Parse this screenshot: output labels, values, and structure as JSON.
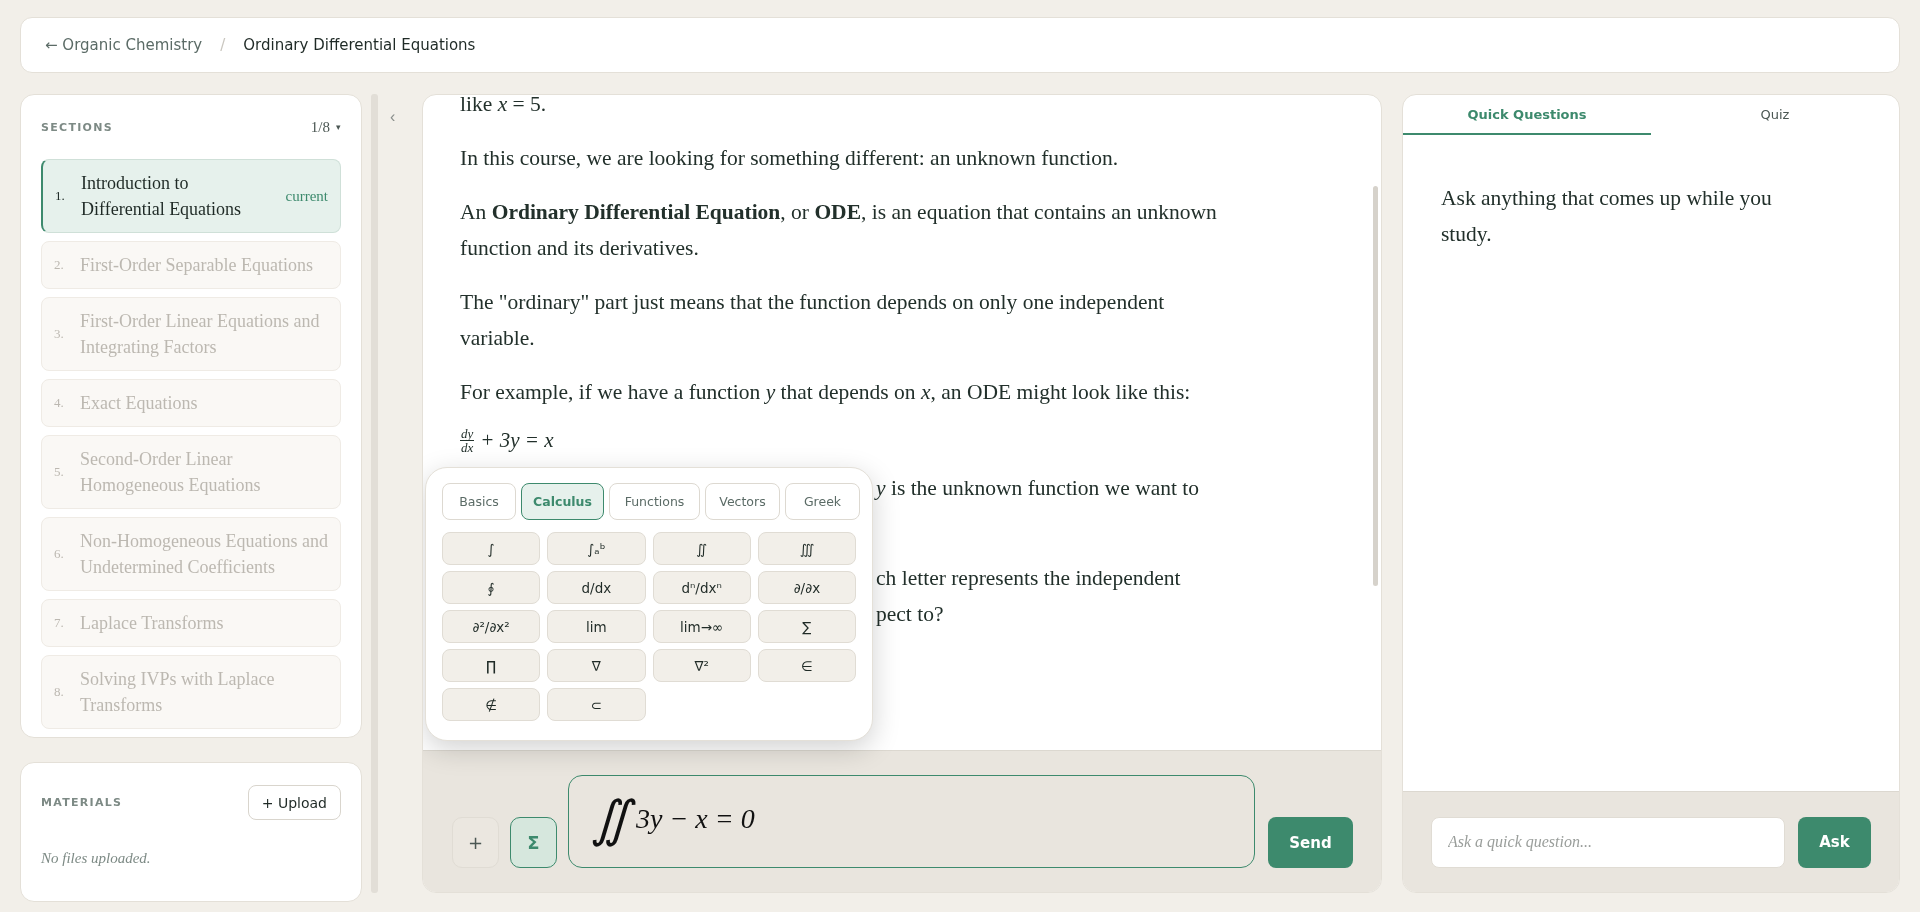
{
  "breadcrumb": {
    "back": "← Organic Chemistry",
    "separator": "/",
    "current": "Ordinary Differential Equations"
  },
  "sections": {
    "heading": "SECTIONS",
    "counter": "1/8",
    "dropdown": "▾",
    "items": [
      {
        "number": "1.",
        "title": "Introduction to Differential Equations",
        "badge": "current",
        "selected": true,
        "disabled": false
      },
      {
        "number": "2.",
        "title": "First-Order Separable Equations",
        "selected": false,
        "disabled": true
      },
      {
        "number": "3.",
        "title": "First-Order Linear Equations and Integrating Factors",
        "selected": false,
        "disabled": true
      },
      {
        "number": "4.",
        "title": "Exact Equations",
        "selected": false,
        "disabled": true
      },
      {
        "number": "5.",
        "title": "Second-Order Linear Homogeneous Equations",
        "selected": false,
        "disabled": true
      },
      {
        "number": "6.",
        "title": "Non-Homogeneous Equations and Undetermined Coefficients",
        "selected": false,
        "disabled": true
      },
      {
        "number": "7.",
        "title": "Laplace Transforms",
        "selected": false,
        "disabled": true
      },
      {
        "number": "8.",
        "title": "Solving IVPs with Laplace Transforms",
        "selected": false,
        "disabled": true
      }
    ]
  },
  "collapse": "‹",
  "materials": {
    "heading": "MATERIALS",
    "upload": "+ Upload",
    "empty": "No files uploaded."
  },
  "lesson": {
    "blocks": [
      {
        "kind": "text",
        "text": "like *x* = 5."
      },
      {
        "kind": "text",
        "text": "In this course, we are looking for something different: an unknown function."
      },
      {
        "kind": "text",
        "text": "An **Ordinary Differential Equation**, or **ODE**, is an equation that contains an unknown function and its derivatives."
      },
      {
        "kind": "text",
        "text": "The \"ordinary\" part just means that the function depends on only one independent variable."
      },
      {
        "kind": "text",
        "text": "For example, if we have a function *y* that depends on *x*, an ODE might look like this:"
      },
      {
        "kind": "equation",
        "numerator": "dy",
        "denominator": "dx",
        "rest": "+ 3y = x"
      },
      {
        "kind": "partial",
        "lines": [
          "*y* is the unknown function we want to"
        ]
      },
      {
        "kind": "partial",
        "lines": [
          "ch letter represents the independent",
          "pect to?"
        ]
      }
    ]
  },
  "palette": {
    "tabs": [
      {
        "label": "Basics",
        "selected": false
      },
      {
        "label": "Calculus",
        "selected": true
      },
      {
        "label": "Functions",
        "selected": false
      },
      {
        "label": "Vectors",
        "selected": false
      },
      {
        "label": "Greek",
        "selected": false
      }
    ],
    "keys": [
      "∫",
      "∫ₐᵇ",
      "∬",
      "∭",
      "∮",
      "d/dx",
      "dⁿ/dxⁿ",
      "∂/∂x",
      "∂²/∂x²",
      "lim",
      "lim→∞",
      "∑",
      "∏",
      "∇",
      "∇²",
      "∈",
      "∉",
      "⊂"
    ]
  },
  "composer": {
    "add_button": "+",
    "math_button": {
      "label": "Σ",
      "on": true
    },
    "input": {
      "symbol": "∬",
      "expression": "3y − x = 0"
    },
    "send": "Send"
  },
  "quick": {
    "tabs": [
      {
        "label": "Quick Questions",
        "selected": true
      },
      {
        "label": "Quiz",
        "selected": false
      }
    ],
    "intro": "Ask anything that comes up while you study.",
    "input": {
      "placeholder": "Ask a quick question..."
    },
    "ask": "Ask"
  }
}
